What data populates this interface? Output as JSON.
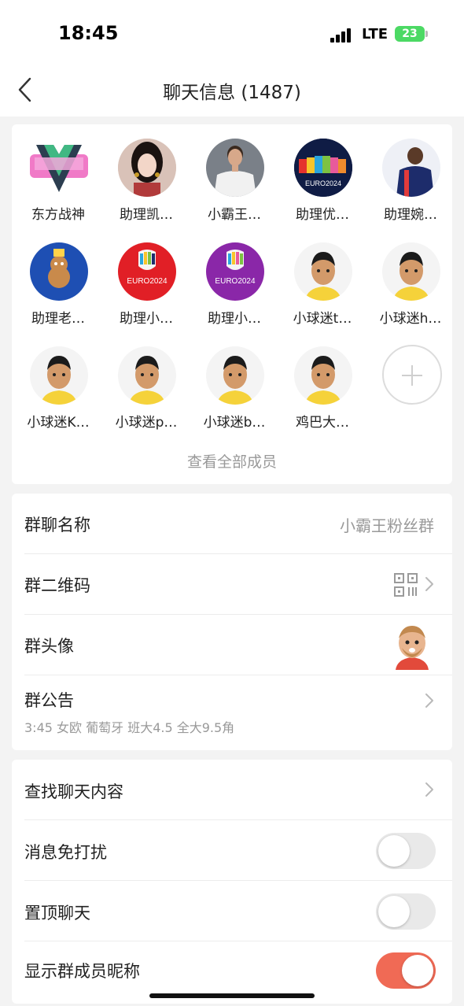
{
  "status_bar": {
    "time": "18:45",
    "network": "LTE",
    "battery": "23"
  },
  "header": {
    "title": "聊天信息 (1487)"
  },
  "members": [
    {
      "name": "东方战神"
    },
    {
      "name": "助理凯…"
    },
    {
      "name": "小霸王…"
    },
    {
      "name": "助理优…"
    },
    {
      "name": "助理婉…"
    },
    {
      "name": "助理老…"
    },
    {
      "name": "助理小…"
    },
    {
      "name": "助理小…"
    },
    {
      "name": "小球迷t…"
    },
    {
      "name": "小球迷h…"
    },
    {
      "name": "小球迷K…"
    },
    {
      "name": "小球迷p…"
    },
    {
      "name": "小球迷b…"
    },
    {
      "name": "鸡巴大…"
    }
  ],
  "view_all_label": "查看全部成员",
  "group_info": {
    "name_label": "群聊名称",
    "name_value": "小霸王粉丝群",
    "qrcode_label": "群二维码",
    "avatar_label": "群头像",
    "notice_label": "群公告",
    "notice_text": "3:45 女欧 葡萄牙 班大4.5 全大9.5角"
  },
  "settings": {
    "search_label": "查找聊天内容",
    "mute_label": "消息免打扰",
    "mute_on": false,
    "pin_label": "置顶聊天",
    "pin_on": false,
    "nickname_label": "显示群成员昵称",
    "nickname_on": true
  },
  "colors": {
    "accent": "#f06a55",
    "toggle_off": "#e9e9e9",
    "secondary_text": "#999999"
  }
}
